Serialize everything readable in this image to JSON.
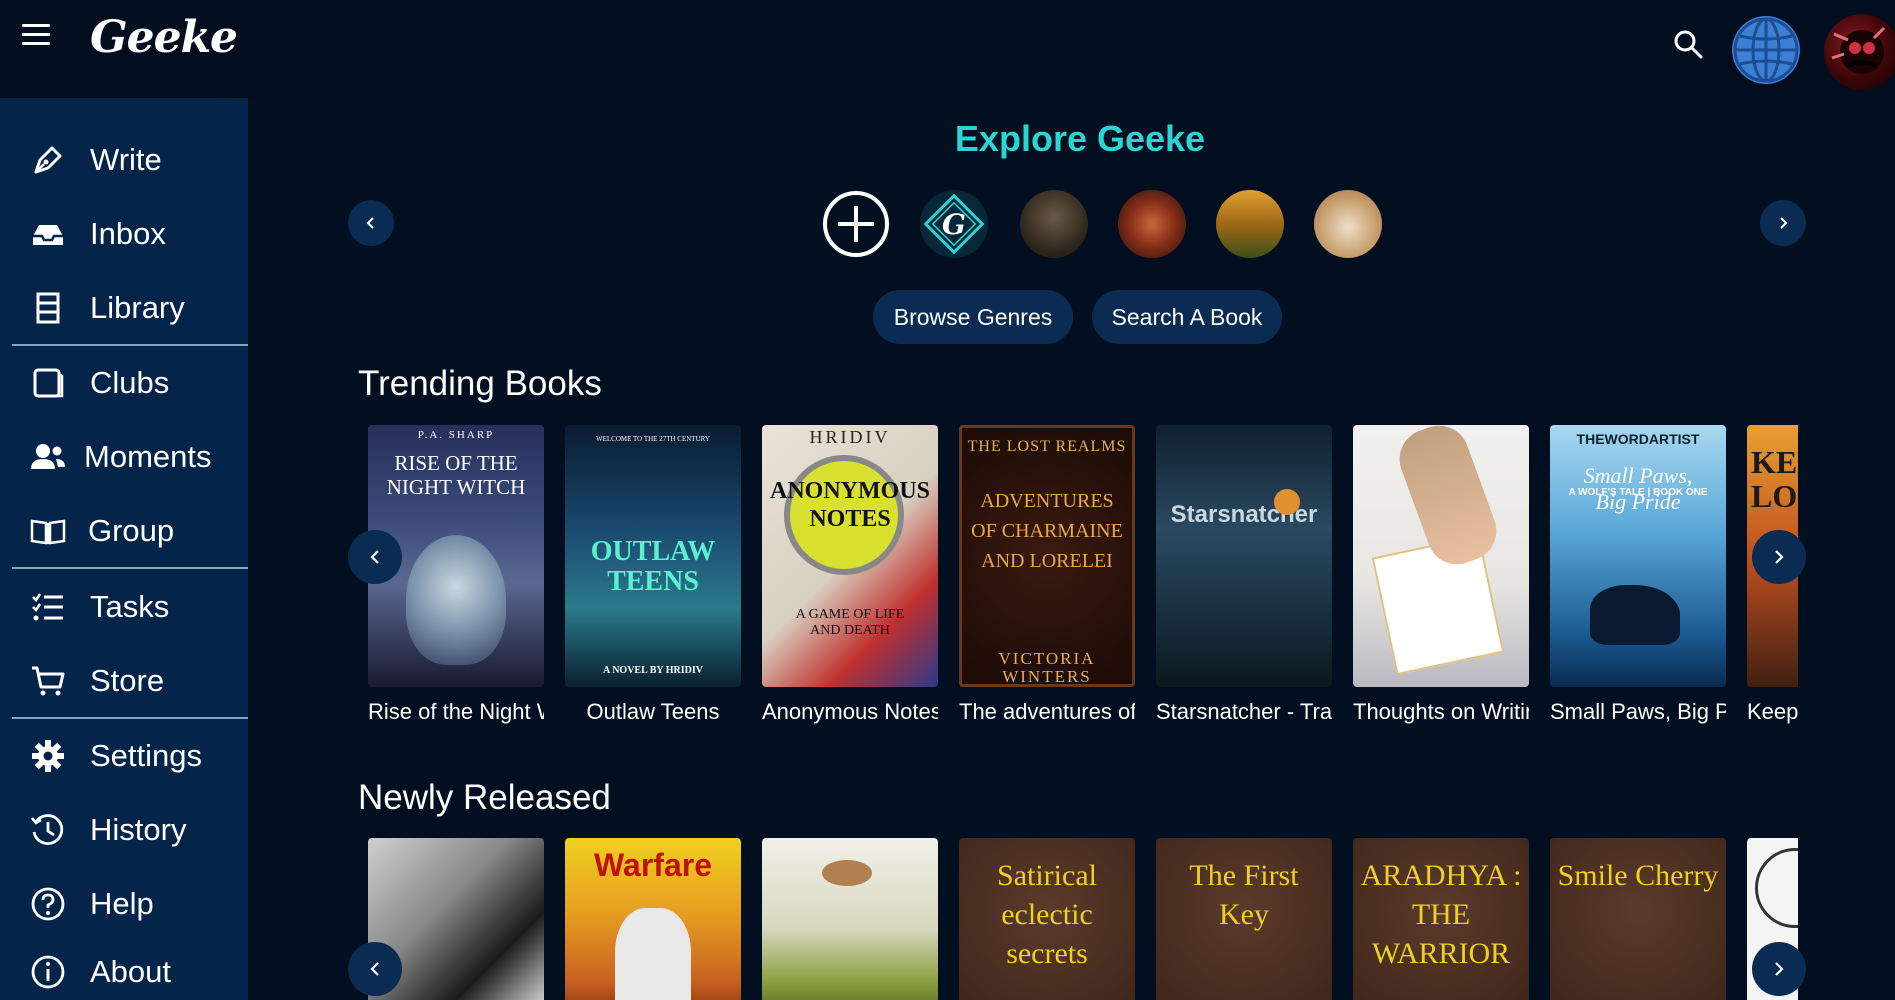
{
  "brand": {
    "logo_text": "Geeke"
  },
  "topbar": {
    "menu_icon": "hamburger-icon",
    "search_icon": "search-icon",
    "language_icon": "globe-icon",
    "avatar_icon": "user-avatar"
  },
  "sidebar": {
    "items": [
      {
        "label": "Write",
        "icon": "pen-icon"
      },
      {
        "label": "Inbox",
        "icon": "inbox-icon"
      },
      {
        "label": "Library",
        "icon": "library-icon"
      },
      {
        "label": "Clubs",
        "icon": "clubs-icon"
      },
      {
        "label": "Moments",
        "icon": "users-icon"
      },
      {
        "label": "Group",
        "icon": "book-open-icon"
      },
      {
        "label": "Tasks",
        "icon": "tasks-icon"
      },
      {
        "label": "Store",
        "icon": "cart-icon"
      },
      {
        "label": "Settings",
        "icon": "gear-icon"
      },
      {
        "label": "History",
        "icon": "history-icon"
      },
      {
        "label": "Help",
        "icon": "help-icon"
      },
      {
        "label": "About",
        "icon": "info-icon"
      }
    ]
  },
  "explore": {
    "title": "Explore Geeke",
    "stories": [
      "add-story",
      "geeke-logo",
      "wolf-warrior",
      "red-hair-girl",
      "golden-city",
      "kitten"
    ],
    "browse_genres_label": "Browse Genres",
    "search_book_label": "Search A Book"
  },
  "trending": {
    "title": "Trending Books",
    "books": [
      {
        "title": "Rise of the Night Witch",
        "cover_author": "P.A. SHARP",
        "cover_title": "RISE OF THE NIGHT WITCH"
      },
      {
        "title": "Outlaw Teens",
        "cover_top": "WELCOME TO THE 27TH CENTURY",
        "cover_title": "OUTLAW TEENS",
        "cover_author": "A NOVEL BY HRIDIV"
      },
      {
        "title": "Anonymous Notes",
        "cover_author": "HRIDIV",
        "cover_title": "ANONYMOUS NOTES",
        "cover_subtitle": "A GAME OF LIFE AND DEATH"
      },
      {
        "title": "The adventures of Charmaine and Lorelei",
        "cover_top": "THE LOST REALMS",
        "cover_title": "ADVENTURES OF CHARMAINE AND LORELEI",
        "cover_author": "VICTORIA WINTERS"
      },
      {
        "title": "Starsnatcher - Trapped",
        "cover_title": "Starsnatcher"
      },
      {
        "title": "Thoughts on Writing"
      },
      {
        "title": "Small Paws, Big Pride",
        "cover_author": "THEWORDARTIST",
        "cover_title": "Small Paws, Big Pride",
        "cover_subtitle": "A WOLF'S TALE | BOOK ONE"
      },
      {
        "title": "Keep",
        "cover_title": "KEEP LOSING"
      }
    ]
  },
  "newly": {
    "title": "Newly Released",
    "books": [
      {
        "cover_title": ""
      },
      {
        "cover_title": "Warfare"
      },
      {
        "cover_title": ""
      },
      {
        "cover_title": "Satirical eclectic secrets"
      },
      {
        "cover_title": "The First Key"
      },
      {
        "cover_title": "ARADHYA : THE WARRIOR"
      },
      {
        "cover_title": "Smile Cherry"
      },
      {
        "cover_title": ""
      }
    ]
  },
  "colors": {
    "accent": "#2ad6d1",
    "background": "#020f20",
    "sidebar": "#04244a",
    "pill": "#0a2c52",
    "nr_text": "#f0d020"
  }
}
